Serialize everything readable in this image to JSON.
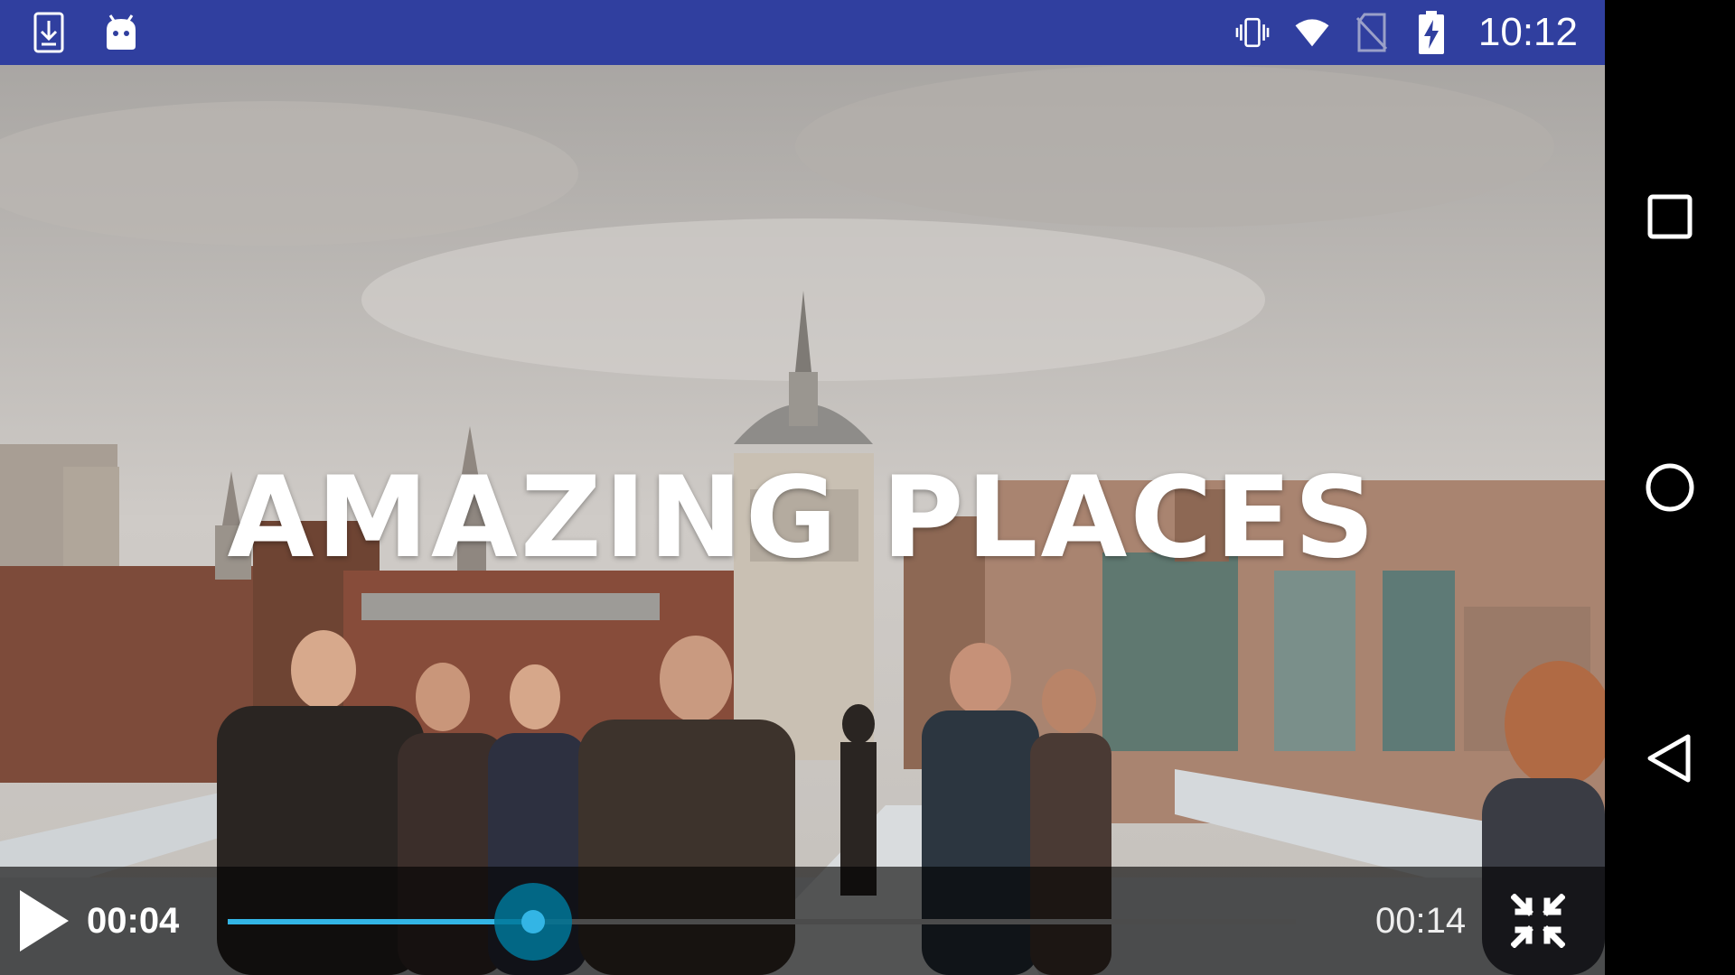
{
  "status_bar": {
    "time": "10:12",
    "bg_color": "#303f9f",
    "left_icons": [
      "download-notification-icon",
      "android-debug-icon"
    ],
    "right_icons": [
      "vibrate-icon",
      "wifi-icon",
      "no-sim-icon",
      "battery-charging-icon"
    ]
  },
  "video": {
    "overlay_title": "AMAZING PLACES"
  },
  "player": {
    "current_time": "00:04",
    "total_time": "00:14",
    "progress": 0.286,
    "accent_color": "#33b5e5",
    "play_icon": "play-icon",
    "fullscreen_icon": "exit-fullscreen-icon"
  },
  "nav_bar": {
    "buttons": [
      "recents-button",
      "home-button",
      "back-button"
    ]
  }
}
